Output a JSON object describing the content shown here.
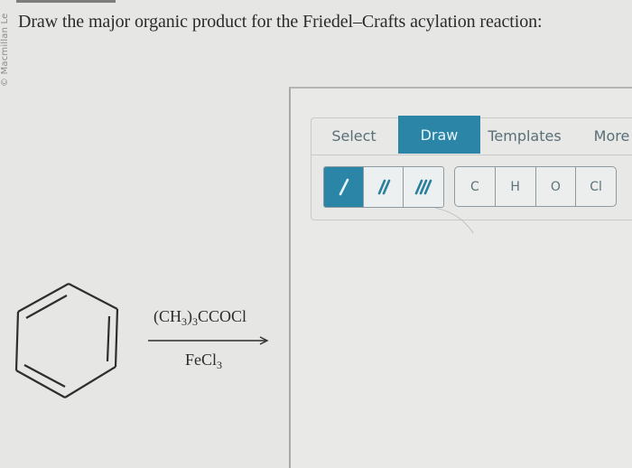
{
  "watermark": "© Macmillan Le",
  "question": {
    "text": "Draw the major organic product for the Friedel–Crafts acylation reaction:"
  },
  "reaction": {
    "reactant": "benzene",
    "reagent_top": {
      "parts": [
        "(CH",
        "3",
        ")",
        "3",
        "CCOCl"
      ]
    },
    "reagent_bottom": {
      "parts": [
        "FeCl",
        "3"
      ]
    },
    "arrow": "right-arrow"
  },
  "editor": {
    "tabs": [
      {
        "label": "Select",
        "active": false
      },
      {
        "label": "Draw",
        "active": true
      },
      {
        "label": "Templates",
        "active": false
      },
      {
        "label": "More",
        "active": false
      }
    ],
    "bond_tools": [
      {
        "name": "single-bond",
        "active": true
      },
      {
        "name": "double-bond",
        "active": false
      },
      {
        "name": "triple-bond",
        "active": false
      }
    ],
    "atom_tools": [
      "C",
      "H",
      "O",
      "Cl"
    ],
    "canvas_content": ""
  },
  "colors": {
    "accent": "#2a85a7",
    "tab_text": "#5a6f78",
    "background": "#e6e6e4"
  }
}
